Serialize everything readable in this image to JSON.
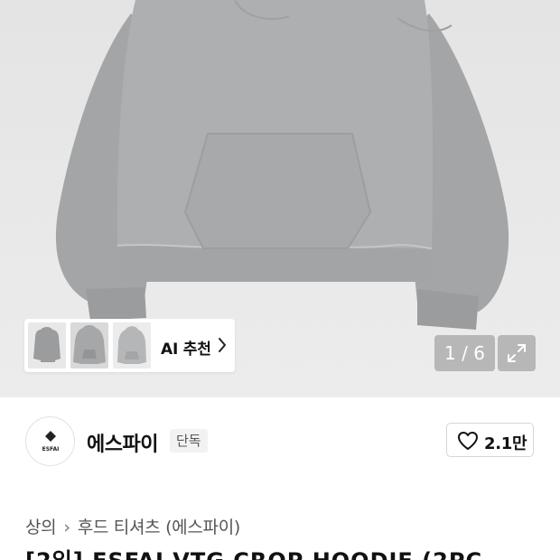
{
  "gallery": {
    "counter": "1 / 6",
    "ai_recommend_label": "AI 추천",
    "thumbnails": [
      "hoodie-thumbnail",
      "hoodie-thumbnail",
      "hoodie-thumbnail"
    ]
  },
  "brand": {
    "name": "에스파이",
    "logo_text": "ESFAI",
    "badge": "단독",
    "like_count": "2.1만"
  },
  "breadcrumb": {
    "items": [
      "상의",
      "후드 티셔츠 (에스파이)"
    ]
  },
  "product": {
    "title": "[2입] ESFAI VTG CROP HOODIE (2PC"
  },
  "colors": {
    "hoodie": "#a9abad",
    "hero_bg": "#e6e6e6",
    "overlay": "#8c8c8c"
  },
  "icons": {
    "chevron": "chevron-right-icon",
    "expand": "expand-icon",
    "heart": "heart-outline-icon"
  }
}
